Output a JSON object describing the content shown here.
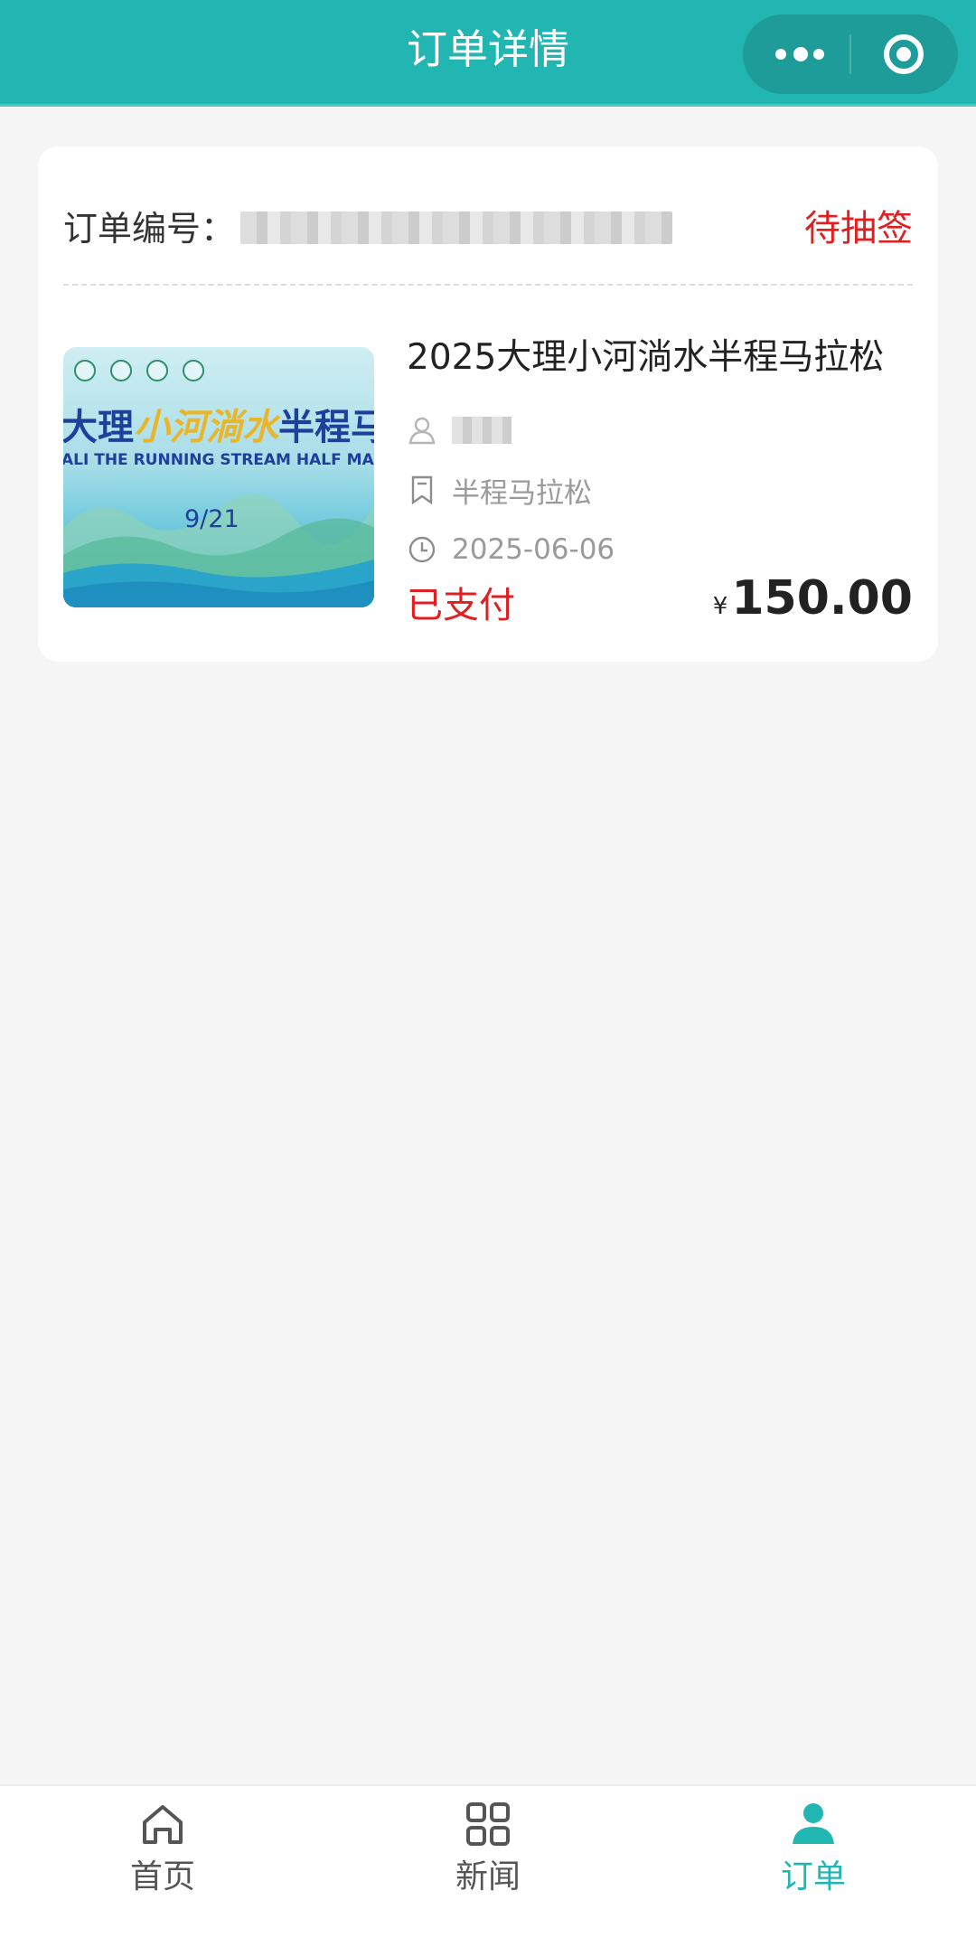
{
  "nav": {
    "title": "订单详情",
    "more_icon": "more-dots-icon",
    "close_icon": "target-close-icon"
  },
  "order": {
    "number_label": "订单编号：",
    "status": "待抽签",
    "poster": {
      "title_parts": [
        "大理",
        "小河淌水",
        "半程马"
      ],
      "subtitle": "ALI THE RUNNING STREAM HALF MAR",
      "date": "9/21"
    },
    "event_title": "2025大理小河淌水半程马拉松",
    "category": "半程马拉松",
    "date": "2025-06-06",
    "pay_status": "已支付",
    "currency": "¥",
    "amount": "150.00"
  },
  "tabs": [
    {
      "label": "首页",
      "icon": "home-icon"
    },
    {
      "label": "新闻",
      "icon": "grid-icon"
    },
    {
      "label": "订单",
      "icon": "user-icon"
    }
  ],
  "colors": {
    "brand": "#22b6b3",
    "alert": "#e02020"
  }
}
